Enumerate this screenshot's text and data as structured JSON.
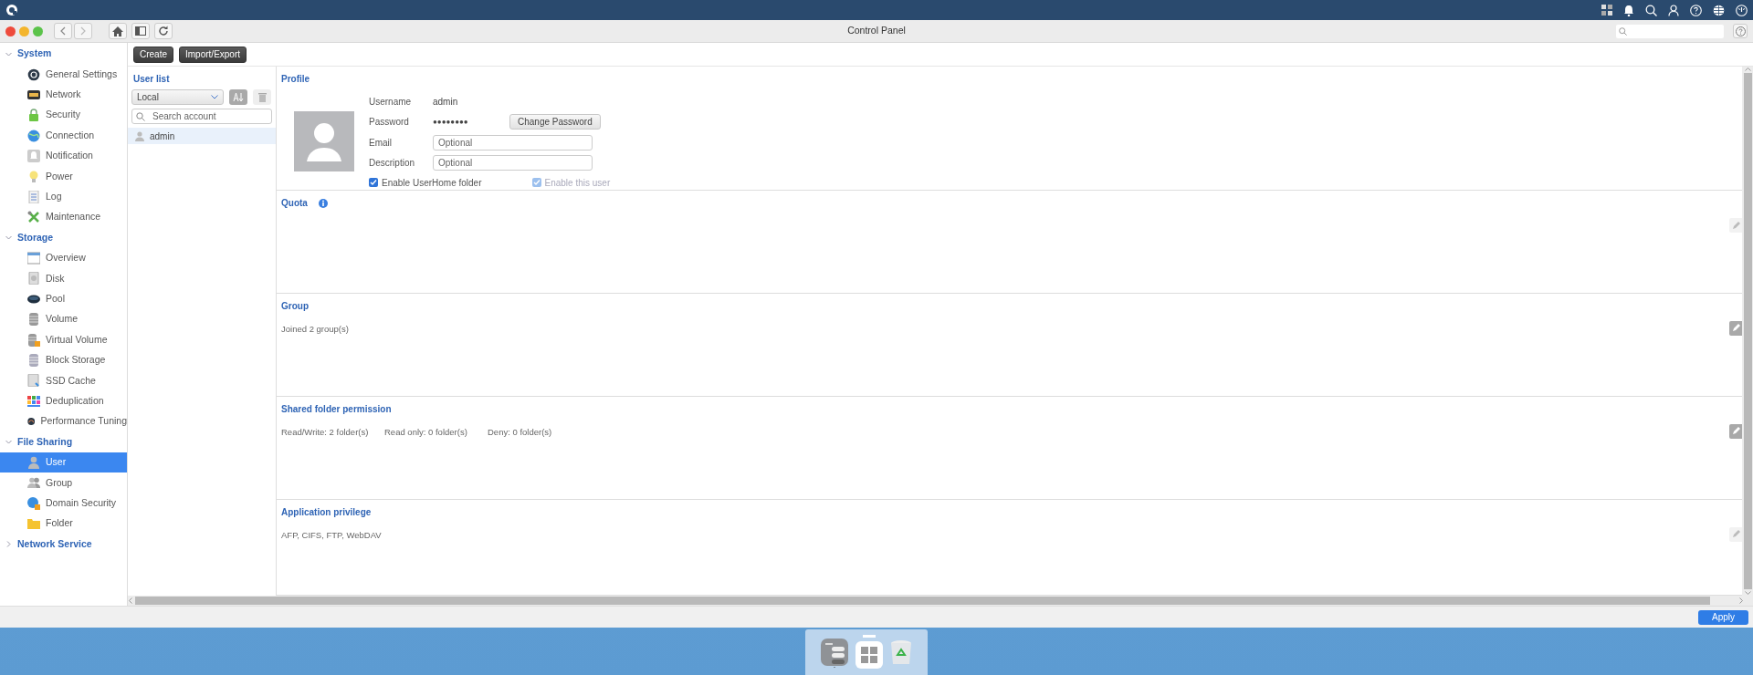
{
  "window": {
    "title": "Control Panel"
  },
  "sidebar": {
    "groups": [
      {
        "label": "System",
        "expanded": true,
        "items": [
          {
            "label": "General Settings",
            "selected": false
          },
          {
            "label": "Network",
            "selected": false
          },
          {
            "label": "Security",
            "selected": false
          },
          {
            "label": "Connection",
            "selected": false
          },
          {
            "label": "Notification",
            "selected": false
          },
          {
            "label": "Power",
            "selected": false
          },
          {
            "label": "Log",
            "selected": false
          },
          {
            "label": "Maintenance",
            "selected": false
          }
        ]
      },
      {
        "label": "Storage",
        "expanded": true,
        "items": [
          {
            "label": "Overview",
            "selected": false
          },
          {
            "label": "Disk",
            "selected": false
          },
          {
            "label": "Pool",
            "selected": false
          },
          {
            "label": "Volume",
            "selected": false
          },
          {
            "label": "Virtual Volume",
            "selected": false
          },
          {
            "label": "Block Storage",
            "selected": false
          },
          {
            "label": "SSD Cache",
            "selected": false
          },
          {
            "label": "Deduplication",
            "selected": false
          },
          {
            "label": "Performance Tuning",
            "selected": false
          }
        ]
      },
      {
        "label": "File Sharing",
        "expanded": true,
        "items": [
          {
            "label": "User",
            "selected": true
          },
          {
            "label": "Group",
            "selected": false
          },
          {
            "label": "Domain Security",
            "selected": false
          },
          {
            "label": "Folder",
            "selected": false
          }
        ]
      },
      {
        "label": "Network Service",
        "expanded": false
      }
    ]
  },
  "actions": [
    "Create",
    "Import/Export"
  ],
  "user_list": {
    "title": "User list",
    "filter": "Local",
    "search": {
      "placeholder": "Search account"
    },
    "users": [
      {
        "name": "admin",
        "selected": true
      }
    ]
  },
  "profile": {
    "title": "Profile",
    "fields": [
      {
        "kind": "text",
        "label": "Username",
        "value": "admin"
      },
      {
        "kind": "password",
        "label": "Password",
        "value": "●●●●●●●●",
        "button": "Change Password"
      },
      {
        "kind": "input",
        "label": "Email",
        "placeholder": "Optional"
      },
      {
        "kind": "input",
        "label": "Description",
        "placeholder": "Optional"
      }
    ],
    "checkboxes": [
      {
        "label": "Enable UserHome folder",
        "checked": true,
        "disabled": false
      },
      {
        "label": "Enable this user",
        "checked": true,
        "disabled": true
      }
    ]
  },
  "sections": [
    {
      "title": "Quota",
      "info": true,
      "edit_enabled": false
    },
    {
      "title": "Group",
      "lines": [
        "Joined 2 group(s)"
      ],
      "edit_enabled": true
    },
    {
      "title": "Shared folder permission",
      "lines": [
        "Read/Write: 2 folder(s)",
        "Read only: 0 folder(s)",
        "Deny: 0 folder(s)"
      ],
      "edit_enabled": true
    },
    {
      "title": "Application privilege",
      "lines": [
        "AFP, CIFS, FTP, WebDAV"
      ],
      "edit_enabled": false
    }
  ],
  "apply_button": "Apply"
}
